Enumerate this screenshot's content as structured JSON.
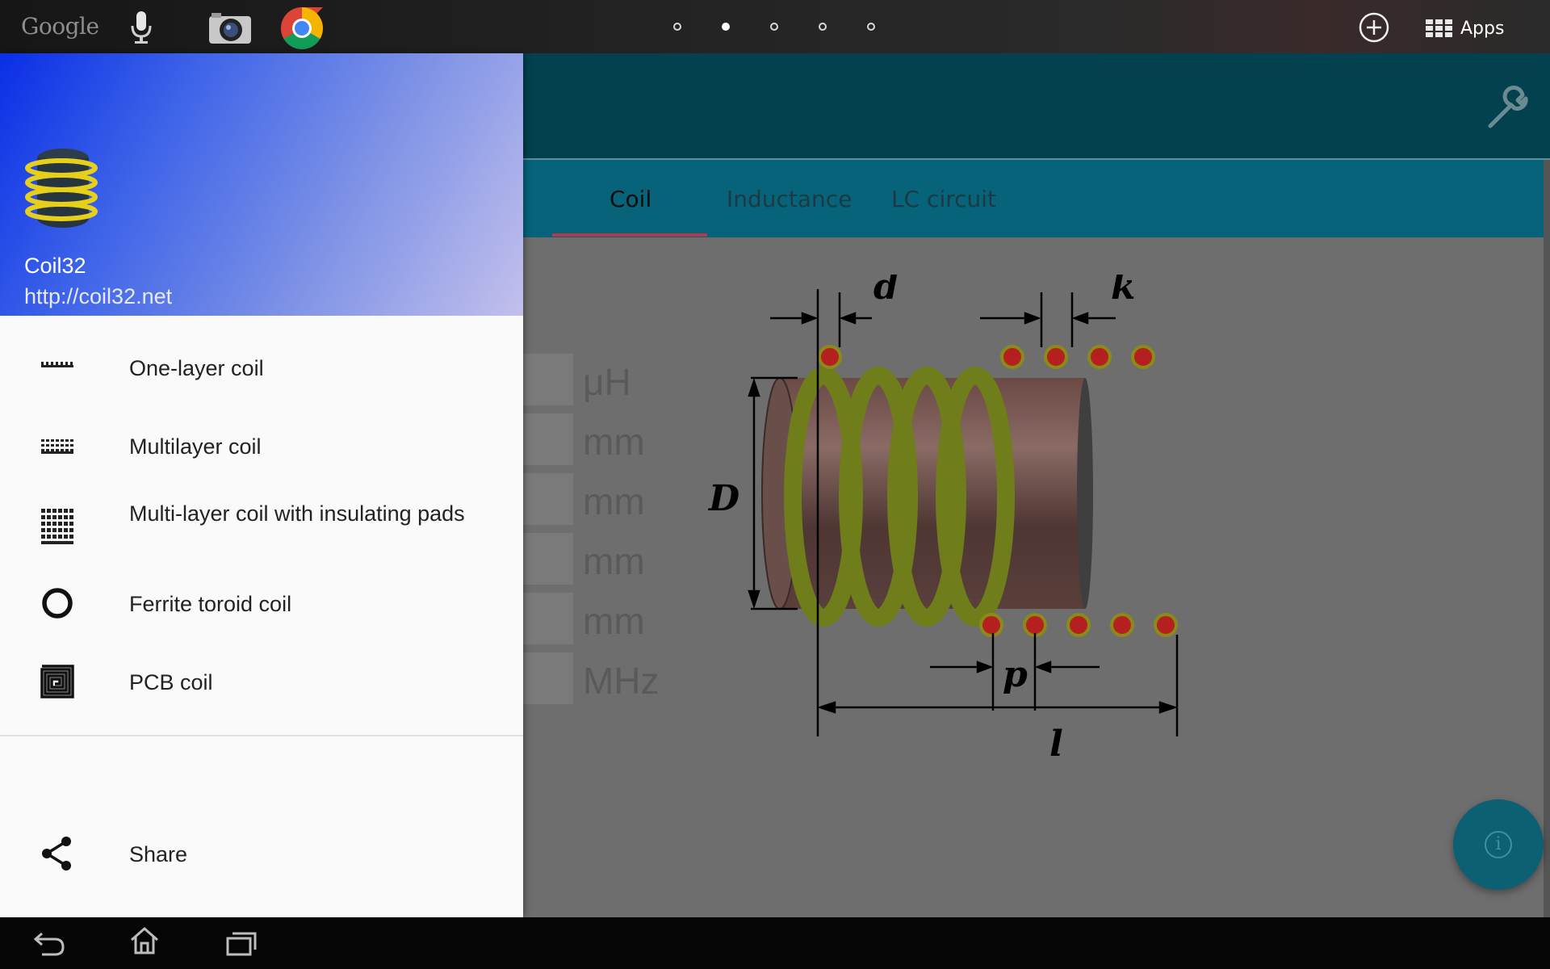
{
  "status_bar": {
    "google_label": "Google",
    "apps_label": "Apps",
    "page_indicator_count": 5,
    "active_page_index": 1,
    "icons": [
      "mic-icon",
      "camera-icon",
      "chrome-icon",
      "add-icon",
      "apps-grid-icon"
    ]
  },
  "drawer": {
    "app_name": "Coil32",
    "app_url": "http://coil32.net",
    "items": [
      {
        "label": "One-layer coil",
        "icon": "one-layer-coil-icon"
      },
      {
        "label": "Multilayer coil",
        "icon": "multilayer-coil-icon"
      },
      {
        "label": "Multi-layer coil with insulating pads",
        "icon": "multilayer-pads-icon"
      },
      {
        "label": "Ferrite toroid coil",
        "icon": "toroid-icon"
      },
      {
        "label": "PCB coil",
        "icon": "pcb-coil-icon"
      }
    ],
    "share_label": "Share"
  },
  "tabs": [
    {
      "label": "Coil",
      "active": true
    },
    {
      "label": "Inductance",
      "active": false
    },
    {
      "label": "LC circuit",
      "active": false
    }
  ],
  "form": {
    "units": [
      "μH",
      "mm",
      "mm",
      "mm",
      "mm",
      "MHz"
    ]
  },
  "diagram": {
    "labels": {
      "d": "d",
      "k": "k",
      "D": "D",
      "p": "p",
      "l": "l"
    }
  },
  "colors": {
    "toolbar": "#03414f",
    "tabs": "#06637a",
    "accent_underline": "#b23a4a",
    "drawer_header_start": "#0a2ee6",
    "drawer_header_end": "#c3c0ec"
  }
}
